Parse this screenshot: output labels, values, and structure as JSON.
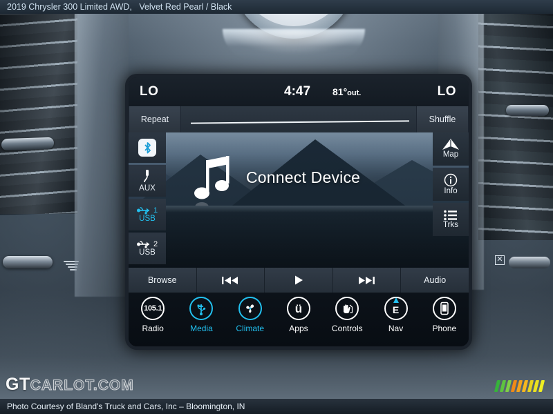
{
  "banner": {
    "vehicle": "2019 Chrysler 300 Limited AWD,",
    "colors": "Velvet Red Pearl / Black",
    "courtesy": "Photo Courtesy of Bland's Truck and Cars, Inc – Bloomington, IN",
    "watermark_bold": "GT",
    "watermark_rest": "CARLOT.COM"
  },
  "head_unit": {
    "status_bar": {
      "left_temp": "LO",
      "clock": "4:47",
      "outside_temp": "81°",
      "outside_label": "out.",
      "right_temp": "LO"
    },
    "playback_controls": {
      "repeat": "Repeat",
      "shuffle": "Shuffle"
    },
    "now_playing": {
      "message": "Connect Device",
      "icon": "music-note-icon"
    },
    "sources": [
      {
        "label": "",
        "icon": "bluetooth-icon",
        "selected": false,
        "name": "bluetooth"
      },
      {
        "label": "AUX",
        "icon": "aux-jack-icon",
        "selected": false,
        "name": "aux"
      },
      {
        "label": "USB",
        "icon": "usb-icon",
        "badge": "1",
        "selected": true,
        "name": "usb-1"
      },
      {
        "label": "USB",
        "icon": "usb-icon",
        "badge": "2",
        "selected": false,
        "name": "usb-2"
      }
    ],
    "side_tools": [
      {
        "label": "Map",
        "icon": "map-arrow-icon",
        "name": "map"
      },
      {
        "label": "Info",
        "icon": "info-circle-icon",
        "name": "info"
      },
      {
        "label": "Trks",
        "icon": "list-icon",
        "name": "tracks"
      }
    ],
    "transport": [
      {
        "label": "Browse",
        "icon": "",
        "name": "browse"
      },
      {
        "label": "",
        "icon": "previous-track-icon",
        "name": "previous"
      },
      {
        "label": "",
        "icon": "play-icon",
        "name": "play"
      },
      {
        "label": "",
        "icon": "next-track-icon",
        "name": "next"
      },
      {
        "label": "Audio",
        "icon": "",
        "name": "audio"
      }
    ],
    "main_menu": [
      {
        "label": "Radio",
        "icon": "radio-frequency-icon",
        "glyph": "105.1",
        "active": false
      },
      {
        "label": "Media",
        "icon": "usb-icon",
        "glyph": "",
        "active": true
      },
      {
        "label": "Climate",
        "icon": "fan-icon",
        "glyph": "",
        "active": true
      },
      {
        "label": "Apps",
        "icon": "uconnect-icon",
        "glyph": "ü",
        "active": false
      },
      {
        "label": "Controls",
        "icon": "hand-controls-icon",
        "glyph": "",
        "active": false
      },
      {
        "label": "Nav",
        "icon": "compass-icon",
        "glyph": "E",
        "active": false
      },
      {
        "label": "Phone",
        "icon": "phone-icon",
        "glyph": "",
        "active": false
      }
    ]
  },
  "colors": {
    "accent": "#22c0ef",
    "text": "#ffffff",
    "banner_text": "#cfe0ef"
  }
}
